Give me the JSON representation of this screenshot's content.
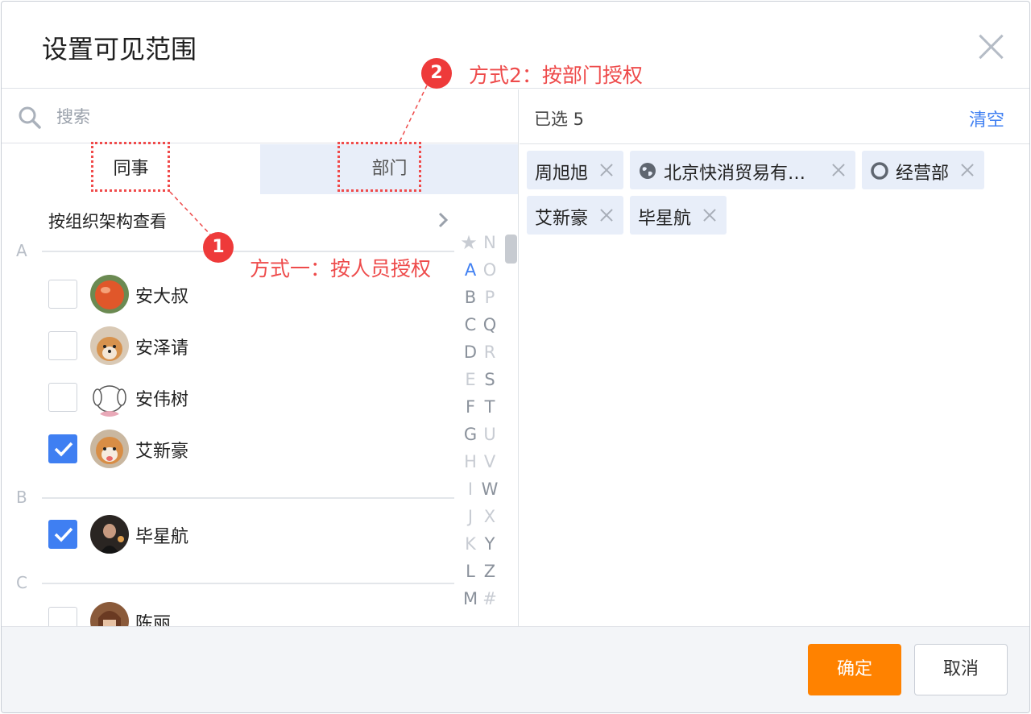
{
  "dialog": {
    "title": "设置可见范围"
  },
  "search": {
    "placeholder": "搜索"
  },
  "tabs": {
    "colleagues": "同事",
    "departments": "部门"
  },
  "org_view_label": "按组织架构查看",
  "sections": [
    {
      "letter": "A",
      "contacts": [
        {
          "name": "安大叔",
          "checked": false
        },
        {
          "name": "安泽请",
          "checked": false
        },
        {
          "name": "安伟树",
          "checked": false
        },
        {
          "name": "艾新豪",
          "checked": true
        }
      ]
    },
    {
      "letter": "B",
      "contacts": [
        {
          "name": "毕星航",
          "checked": true
        }
      ]
    },
    {
      "letter": "C",
      "contacts": [
        {
          "name": "陈丽",
          "checked": false
        }
      ]
    }
  ],
  "alpha_index": {
    "star": "★",
    "left": [
      "A",
      "B",
      "C",
      "D",
      "E",
      "F",
      "G",
      "H",
      "I",
      "J",
      "K",
      "L",
      "M"
    ],
    "right": [
      "N",
      "O",
      "P",
      "Q",
      "R",
      "S",
      "T",
      "U",
      "V",
      "W",
      "X",
      "Y",
      "Z",
      "#"
    ],
    "active": "A"
  },
  "selected": {
    "count_label": "已选 5",
    "clear_label": "清空",
    "items": [
      {
        "label": "周旭旭",
        "icon": "none"
      },
      {
        "label": "北京快消贸易有…",
        "icon": "globe-icon"
      },
      {
        "label": "经营部",
        "icon": "circle-icon"
      },
      {
        "label": "艾新豪",
        "icon": "none"
      },
      {
        "label": "毕星航",
        "icon": "none"
      }
    ]
  },
  "footer": {
    "confirm_label": "确定",
    "cancel_label": "取消"
  },
  "annotations": {
    "badge1": "1",
    "text1": "方式一：按人员授权",
    "badge2": "2",
    "text2": "方式2：按部门授权"
  },
  "colors": {
    "accent_blue": "#3f7ff2",
    "confirm_orange": "#ff8200",
    "annotation_red": "#ee3a3a",
    "tab_inactive_bg": "#e8eef9"
  }
}
